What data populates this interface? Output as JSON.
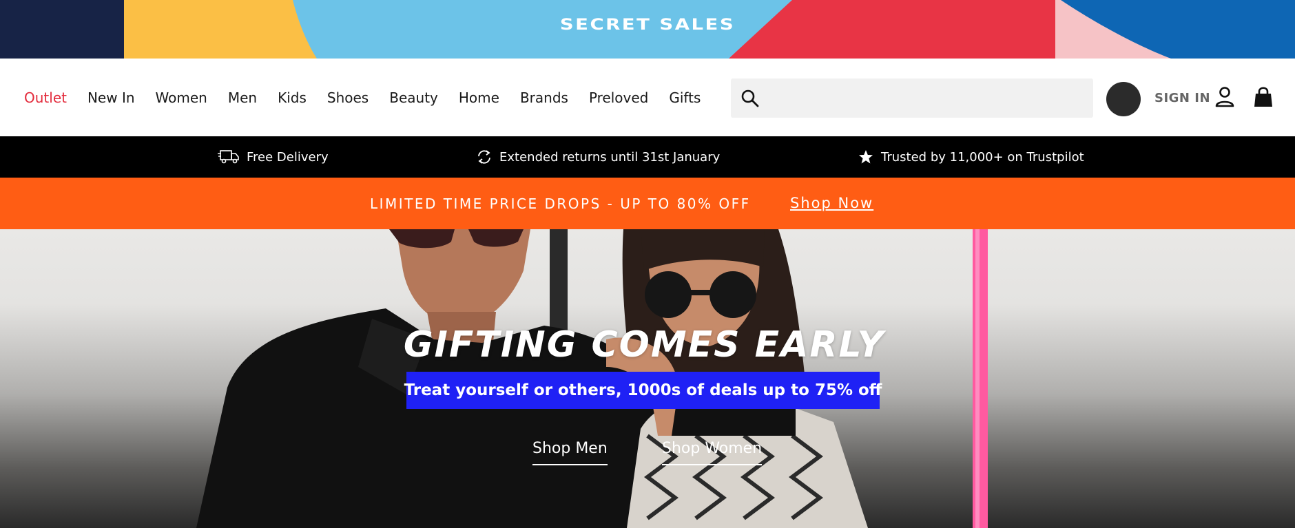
{
  "banner": {
    "brand": "SECRET SALES",
    "colors": [
      "#172346",
      "#fbbf45",
      "#6cc3e8",
      "#e83445",
      "#f6c3c6",
      "#0e66b4"
    ]
  },
  "nav": {
    "links": [
      "Outlet",
      "New In",
      "Women",
      "Men",
      "Kids",
      "Shoes",
      "Beauty",
      "Home",
      "Brands",
      "Preloved",
      "Gifts"
    ],
    "outlet_color": "#e32b3c",
    "search_placeholder": "",
    "sign_in": "SIGN IN",
    "icons": [
      "search-icon",
      "user-icon",
      "shopping-bag-icon"
    ]
  },
  "info_strip": {
    "delivery": "Free Delivery",
    "returns": "Extended returns until 31st January",
    "trust": "Trusted by 11,000+ on Trustpilot",
    "icons": [
      "truck-icon",
      "refresh-icon",
      "star-icon"
    ]
  },
  "promo": {
    "text": "LIMITED TIME PRICE DROPS - UP TO 80% OFF",
    "link": "Shop Now",
    "color": "#ff5d14"
  },
  "hero": {
    "title": "GIFTING COMES EARLY",
    "subtitle": "Treat yourself or others, 1000s of deals up to 75% off",
    "subtitle_bg": "#1f21f5",
    "cta_men": "Shop Men",
    "cta_women": "Shop Women"
  }
}
